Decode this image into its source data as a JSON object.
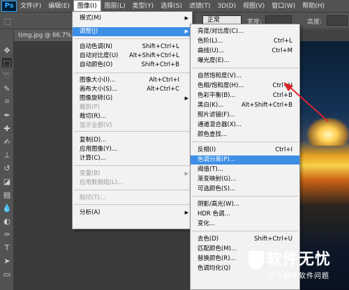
{
  "app": {
    "logo": "Ps"
  },
  "menubar": {
    "items": [
      "文件(F)",
      "编辑(E)",
      "图像(I)",
      "图层(L)",
      "类型(Y)",
      "选择(S)",
      "滤镜(T)",
      "3D(D)",
      "视图(V)",
      "窗口(W)",
      "帮助(H)"
    ],
    "active_index": 2
  },
  "optionsbar": {
    "blend_mode": "正常",
    "width_label": "宽度:",
    "height_label": "高度:"
  },
  "document": {
    "tab_label": "timg.jpg @ 66.7%"
  },
  "image_menu": {
    "items": [
      {
        "label": "模式(M)",
        "shortcut": "",
        "submenu": true,
        "disabled": false
      },
      {
        "label": "调整(J)",
        "shortcut": "",
        "submenu": true,
        "disabled": false,
        "highlight": true
      },
      {
        "label": "自动色调(N)",
        "shortcut": "Shift+Ctrl+L",
        "disabled": false
      },
      {
        "label": "自动对比度(U)",
        "shortcut": "Alt+Shift+Ctrl+L",
        "disabled": false
      },
      {
        "label": "自动颜色(O)",
        "shortcut": "Shift+Ctrl+B",
        "disabled": false
      },
      {
        "label": "图像大小(I)...",
        "shortcut": "Alt+Ctrl+I",
        "disabled": false
      },
      {
        "label": "画布大小(S)...",
        "shortcut": "Alt+Ctrl+C",
        "disabled": false
      },
      {
        "label": "图像旋转(G)",
        "shortcut": "",
        "submenu": true,
        "disabled": false
      },
      {
        "label": "裁剪(P)",
        "shortcut": "",
        "disabled": true
      },
      {
        "label": "裁切(R)...",
        "shortcut": "",
        "disabled": false
      },
      {
        "label": "显示全部(V)",
        "shortcut": "",
        "disabled": true
      },
      {
        "label": "复制(D)...",
        "shortcut": "",
        "disabled": false
      },
      {
        "label": "应用图像(Y)...",
        "shortcut": "",
        "disabled": false
      },
      {
        "label": "计算(C)...",
        "shortcut": "",
        "disabled": false
      },
      {
        "label": "变量(B)",
        "shortcut": "",
        "submenu": true,
        "disabled": true
      },
      {
        "label": "应用数据组(L)...",
        "shortcut": "",
        "disabled": true
      },
      {
        "label": "陷印(T)...",
        "shortcut": "",
        "disabled": true
      },
      {
        "label": "分析(A)",
        "shortcut": "",
        "submenu": true,
        "disabled": false
      }
    ]
  },
  "adjust_menu": {
    "items": [
      {
        "label": "亮度/对比度(C)...",
        "shortcut": ""
      },
      {
        "label": "色阶(L)...",
        "shortcut": "Ctrl+L"
      },
      {
        "label": "曲线(U)...",
        "shortcut": "Ctrl+M"
      },
      {
        "label": "曝光度(E)...",
        "shortcut": ""
      },
      {
        "label": "自然饱和度(V)...",
        "shortcut": ""
      },
      {
        "label": "色相/饱和度(H)...",
        "shortcut": "Ctrl+U"
      },
      {
        "label": "色彩平衡(B)...",
        "shortcut": "Ctrl+B"
      },
      {
        "label": "黑白(K)...",
        "shortcut": "Alt+Shift+Ctrl+B"
      },
      {
        "label": "照片滤镜(F)...",
        "shortcut": ""
      },
      {
        "label": "通道混合器(X)...",
        "shortcut": ""
      },
      {
        "label": "颜色查找...",
        "shortcut": ""
      },
      {
        "label": "反相(I)",
        "shortcut": "Ctrl+I"
      },
      {
        "label": "色调分离(P)...",
        "shortcut": "",
        "highlight": true
      },
      {
        "label": "阈值(T)...",
        "shortcut": ""
      },
      {
        "label": "渐变映射(G)...",
        "shortcut": ""
      },
      {
        "label": "可选颜色(S)...",
        "shortcut": ""
      },
      {
        "label": "阴影/高光(W)...",
        "shortcut": ""
      },
      {
        "label": "HDR 色调...",
        "shortcut": ""
      },
      {
        "label": "变化...",
        "shortcut": ""
      },
      {
        "label": "去色(D)",
        "shortcut": "Shift+Ctrl+U"
      },
      {
        "label": "匹配颜色(M)...",
        "shortcut": ""
      },
      {
        "label": "替换颜色(R)...",
        "shortcut": ""
      },
      {
        "label": "色调均化(Q)",
        "shortcut": ""
      }
    ]
  },
  "watermark": {
    "title": "软件无忧",
    "subtitle": "努力解决软件问题"
  },
  "colors": {
    "highlight": "#3d8ee6",
    "annotation_arrow": "#d9262b"
  }
}
